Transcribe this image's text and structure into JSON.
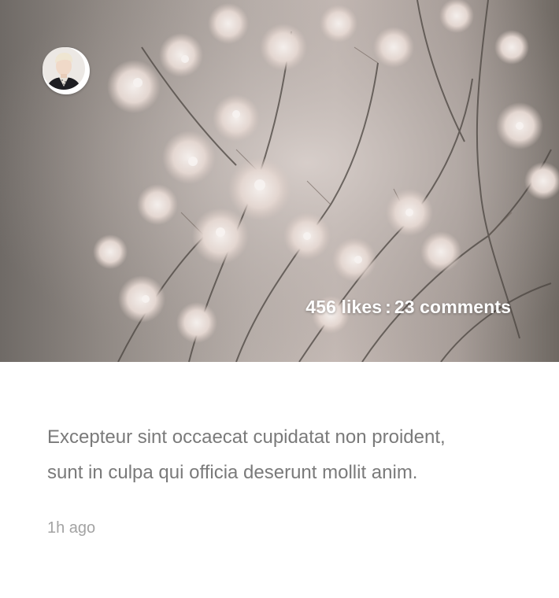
{
  "post": {
    "image": "dried-flowers-photo",
    "avatar": "user-avatar",
    "likes_text": "456 likes",
    "separator": ":",
    "comments_text": "23 comments",
    "body_line1": "Excepteur sint occaecat cupidatat non proident,",
    "body_line2": "sunt in culpa qui officia deserunt mollit anim.",
    "timestamp": "1h ago"
  }
}
